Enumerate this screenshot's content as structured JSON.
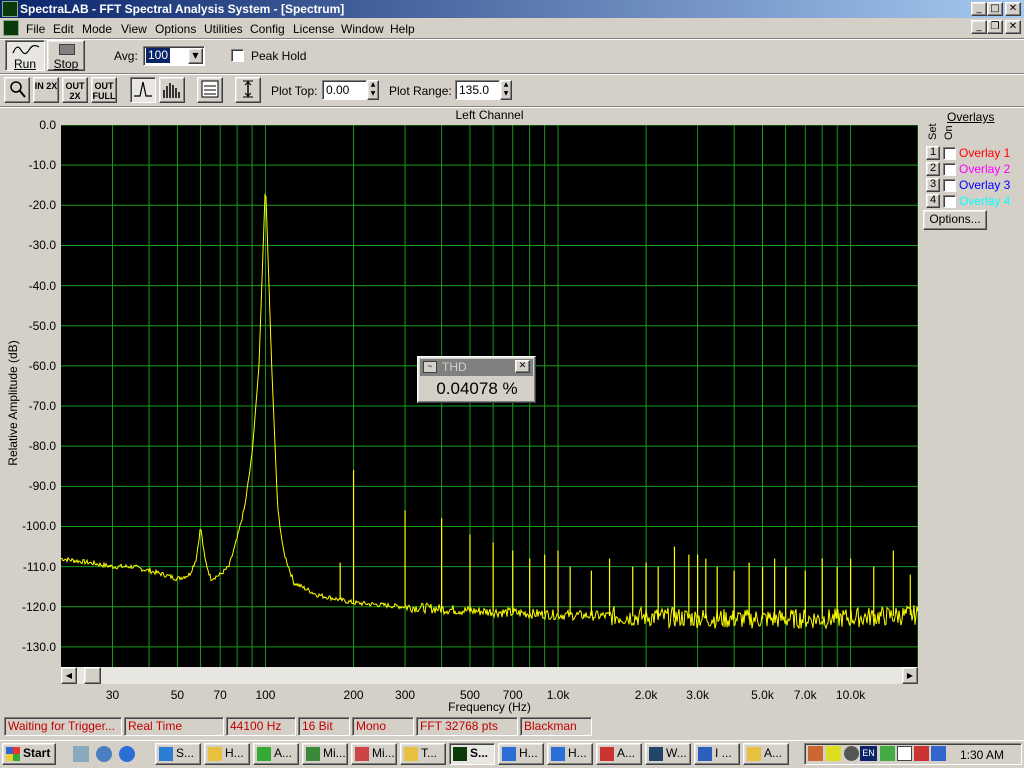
{
  "window": {
    "title": "SpectraLAB - FFT Spectral Analysis System - [Spectrum]",
    "caption_minimize": "_",
    "caption_maximize": "□",
    "caption_close": "✕",
    "caption_restore": "❐"
  },
  "menu": [
    "File",
    "Edit",
    "Mode",
    "View",
    "Options",
    "Utilities",
    "Config",
    "License",
    "Window",
    "Help"
  ],
  "toolbar": {
    "run_label": "Run",
    "stop_label": "Stop",
    "avg_label": "Avg:",
    "avg_value": "100",
    "peak_hold_label": "Peak Hold",
    "zoom_in_label": "IN 2X",
    "zoom_out_label": "OUT 2X",
    "zoom_full_label": "OUT FULL",
    "plot_top_label": "Plot Top:",
    "plot_top_value": "0.00",
    "plot_range_label": "Plot Range:",
    "plot_range_value": "135.0"
  },
  "plot": {
    "title": "Left Channel",
    "grid_color": "#1a9a1a",
    "trace_color": "#ffff00"
  },
  "overlays": {
    "title": "Overlays",
    "set_label": "Set",
    "on_label": "On",
    "items": [
      {
        "num": "1",
        "label": "Overlay 1",
        "color": "#ff0000"
      },
      {
        "num": "2",
        "label": "Overlay 2",
        "color": "#ff00ff"
      },
      {
        "num": "3",
        "label": "Overlay 3",
        "color": "#0000ff"
      },
      {
        "num": "4",
        "label": "Overlay 4",
        "color": "#00ffff"
      }
    ],
    "options_label": "Options..."
  },
  "thd": {
    "title": "THD",
    "value": "0.04078 %"
  },
  "status": {
    "trigger": "Waiting for Trigger...",
    "mode": "Real Time",
    "rate": "44100 Hz",
    "bits": "16 Bit",
    "channels": "Mono",
    "fft": "FFT 32768 pts",
    "window": "Blackman"
  },
  "taskbar": {
    "start": "Start",
    "tasks": [
      "S...",
      "H...",
      "A...",
      "Mi...",
      "Mi...",
      "T...",
      "S...",
      "H...",
      "H...",
      "A...",
      "W...",
      "I ...",
      "A..."
    ],
    "tray_lang": "EN",
    "clock": "1:30 AM"
  },
  "chart_data": {
    "type": "line",
    "title": "Left Channel",
    "xlabel": "Frequency (Hz)",
    "ylabel": "Relative Amplitude (dB)",
    "x_scale": "log",
    "xlim": [
      20,
      17000
    ],
    "ylim": [
      -135,
      0
    ],
    "grid": true,
    "y_ticks": [
      "0.0",
      "-10.0",
      "-20.0",
      "-30.0",
      "-40.0",
      "-50.0",
      "-60.0",
      "-70.0",
      "-80.0",
      "-90.0",
      "-100.0",
      "-110.0",
      "-120.0",
      "-130.0"
    ],
    "x_ticks": [
      {
        "v": 30,
        "t": "30"
      },
      {
        "v": 50,
        "t": "50"
      },
      {
        "v": 70,
        "t": "70"
      },
      {
        "v": 100,
        "t": "100"
      },
      {
        "v": 200,
        "t": "200"
      },
      {
        "v": 300,
        "t": "300"
      },
      {
        "v": 500,
        "t": "500"
      },
      {
        "v": 700,
        "t": "700"
      },
      {
        "v": 1000,
        "t": "1.0k"
      },
      {
        "v": 2000,
        "t": "2.0k"
      },
      {
        "v": 3000,
        "t": "3.0k"
      },
      {
        "v": 5000,
        "t": "5.0k"
      },
      {
        "v": 7000,
        "t": "7.0k"
      },
      {
        "v": 10000,
        "t": "10.0k"
      }
    ],
    "series": [
      {
        "name": "Left Channel",
        "baseline": [
          [
            20,
            -108
          ],
          [
            25,
            -109
          ],
          [
            30,
            -110
          ],
          [
            35,
            -110
          ],
          [
            40,
            -111
          ],
          [
            45,
            -112
          ],
          [
            50,
            -113
          ],
          [
            55,
            -112
          ],
          [
            58,
            -108
          ],
          [
            60,
            -100
          ],
          [
            62,
            -108
          ],
          [
            65,
            -113
          ],
          [
            70,
            -112
          ],
          [
            75,
            -110
          ],
          [
            80,
            -103
          ],
          [
            85,
            -95
          ],
          [
            90,
            -82
          ],
          [
            95,
            -60
          ],
          [
            100,
            -14
          ],
          [
            105,
            -60
          ],
          [
            110,
            -95
          ],
          [
            115,
            -106
          ],
          [
            125,
            -114
          ],
          [
            150,
            -117
          ],
          [
            200,
            -119
          ],
          [
            300,
            -120
          ],
          [
            500,
            -121
          ],
          [
            1000,
            -122
          ],
          [
            2000,
            -122.5
          ],
          [
            4000,
            -123
          ],
          [
            8000,
            -123
          ],
          [
            17000,
            -122
          ]
        ],
        "harmonics": [
          [
            180,
            -109
          ],
          [
            200,
            -86
          ],
          [
            300,
            -96
          ],
          [
            400,
            -98
          ],
          [
            500,
            -102
          ],
          [
            600,
            -104
          ],
          [
            700,
            -106
          ],
          [
            800,
            -108
          ],
          [
            900,
            -107
          ],
          [
            1000,
            -106
          ],
          [
            1100,
            -110
          ],
          [
            1300,
            -111
          ],
          [
            1500,
            -108
          ],
          [
            1800,
            -110
          ],
          [
            2000,
            -109
          ],
          [
            2200,
            -110
          ],
          [
            2500,
            -105
          ],
          [
            2800,
            -107
          ],
          [
            3000,
            -107
          ],
          [
            3200,
            -108
          ],
          [
            3500,
            -110
          ],
          [
            4000,
            -111
          ],
          [
            4500,
            -109
          ],
          [
            5000,
            -110
          ],
          [
            5500,
            -108
          ],
          [
            6000,
            -110
          ],
          [
            7000,
            -111
          ],
          [
            8000,
            -108
          ],
          [
            9000,
            -110
          ],
          [
            10000,
            -108
          ],
          [
            12000,
            -110
          ],
          [
            14000,
            -106
          ],
          [
            16000,
            -112
          ]
        ]
      }
    ]
  }
}
